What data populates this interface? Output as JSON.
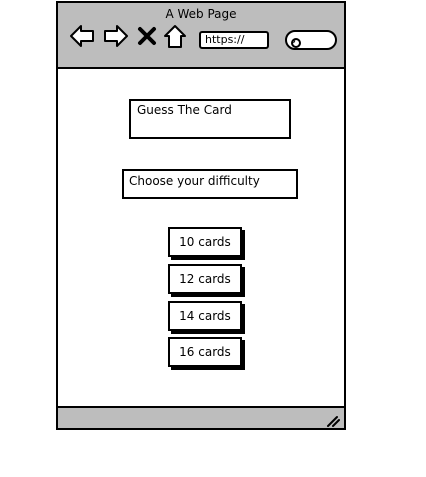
{
  "window": {
    "title": "A Web Page",
    "address_bar": "https://",
    "search_placeholder": ""
  },
  "toolbar": {
    "icons": [
      "back-arrow-icon",
      "forward-arrow-icon",
      "close-icon",
      "home-icon",
      "search-icon"
    ]
  },
  "page": {
    "title": "Guess The Card",
    "subtitle": "Choose your difficulty",
    "buttons": [
      "10 cards",
      "12 cards",
      "14 cards",
      "16 cards"
    ]
  },
  "colors": {
    "chrome": "#bdbdbd",
    "background": "#ffffff",
    "ink": "#000000"
  }
}
